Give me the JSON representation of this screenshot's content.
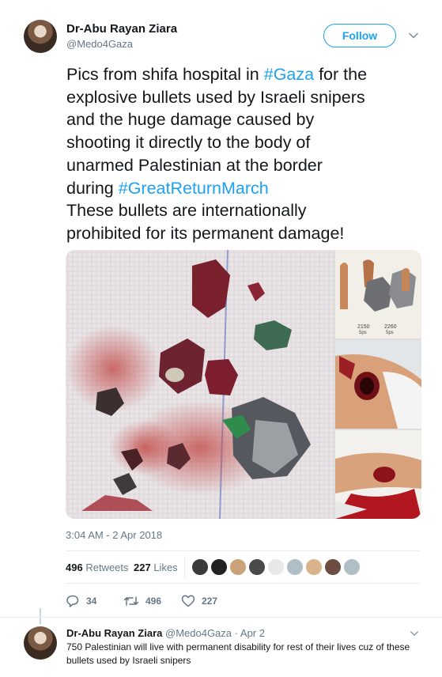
{
  "tweet": {
    "author_name": "Dr-Abu Rayan Ziara",
    "author_handle": "@Medo4Gaza",
    "follow_label": "Follow",
    "text_lines": [
      {
        "before": "Pics from shifa hospital in ",
        "tag": "#Gaza",
        "after": " for the"
      },
      {
        "before": "explosive bullets used by Israeli snipers",
        "tag": "",
        "after": ""
      },
      {
        "before": "and the huge damage caused by",
        "tag": "",
        "after": ""
      },
      {
        "before": "shooting it directly to the body of",
        "tag": "",
        "after": ""
      },
      {
        "before": "unarmed Palestinian at the border",
        "tag": "",
        "after": ""
      },
      {
        "before": "during ",
        "tag": "#GreatReturnMarch",
        "after": ""
      },
      {
        "before": "These bullets are internationally",
        "tag": "",
        "after": ""
      },
      {
        "before": "prohibited for its permanent damage!",
        "tag": "",
        "after": ""
      }
    ],
    "media_labels": {
      "bullet1": "2150",
      "bullet1_sub": "5ps",
      "bullet2": "2260",
      "bullet2_sub": "5ps"
    },
    "timestamp": "3:04 AM - 2 Apr 2018",
    "retweets_count": "496",
    "retweets_label": "Retweets",
    "likes_count": "227",
    "likes_label": "Likes",
    "liker_colors": [
      "#3b3b3b",
      "#222222",
      "#c9a27a",
      "#4a4a4a",
      "#e8e8e8",
      "#b0bec5",
      "#d9b38c",
      "#6d4c41",
      "#b0bec5"
    ],
    "actions": {
      "replies": "34",
      "retweets": "496",
      "likes": "227"
    }
  },
  "reply": {
    "author_name": "Dr-Abu Rayan Ziara",
    "author_handle": "@Medo4Gaza",
    "separator": "·",
    "date": "Apr 2",
    "text": "750 Palestinian will live with permanent disability for rest of their lives cuz of these bullets used by Israeli snipers"
  },
  "colors": {
    "accent": "#1da1f2",
    "muted": "#657786",
    "text": "#14171a",
    "border": "#e6ecf0"
  }
}
